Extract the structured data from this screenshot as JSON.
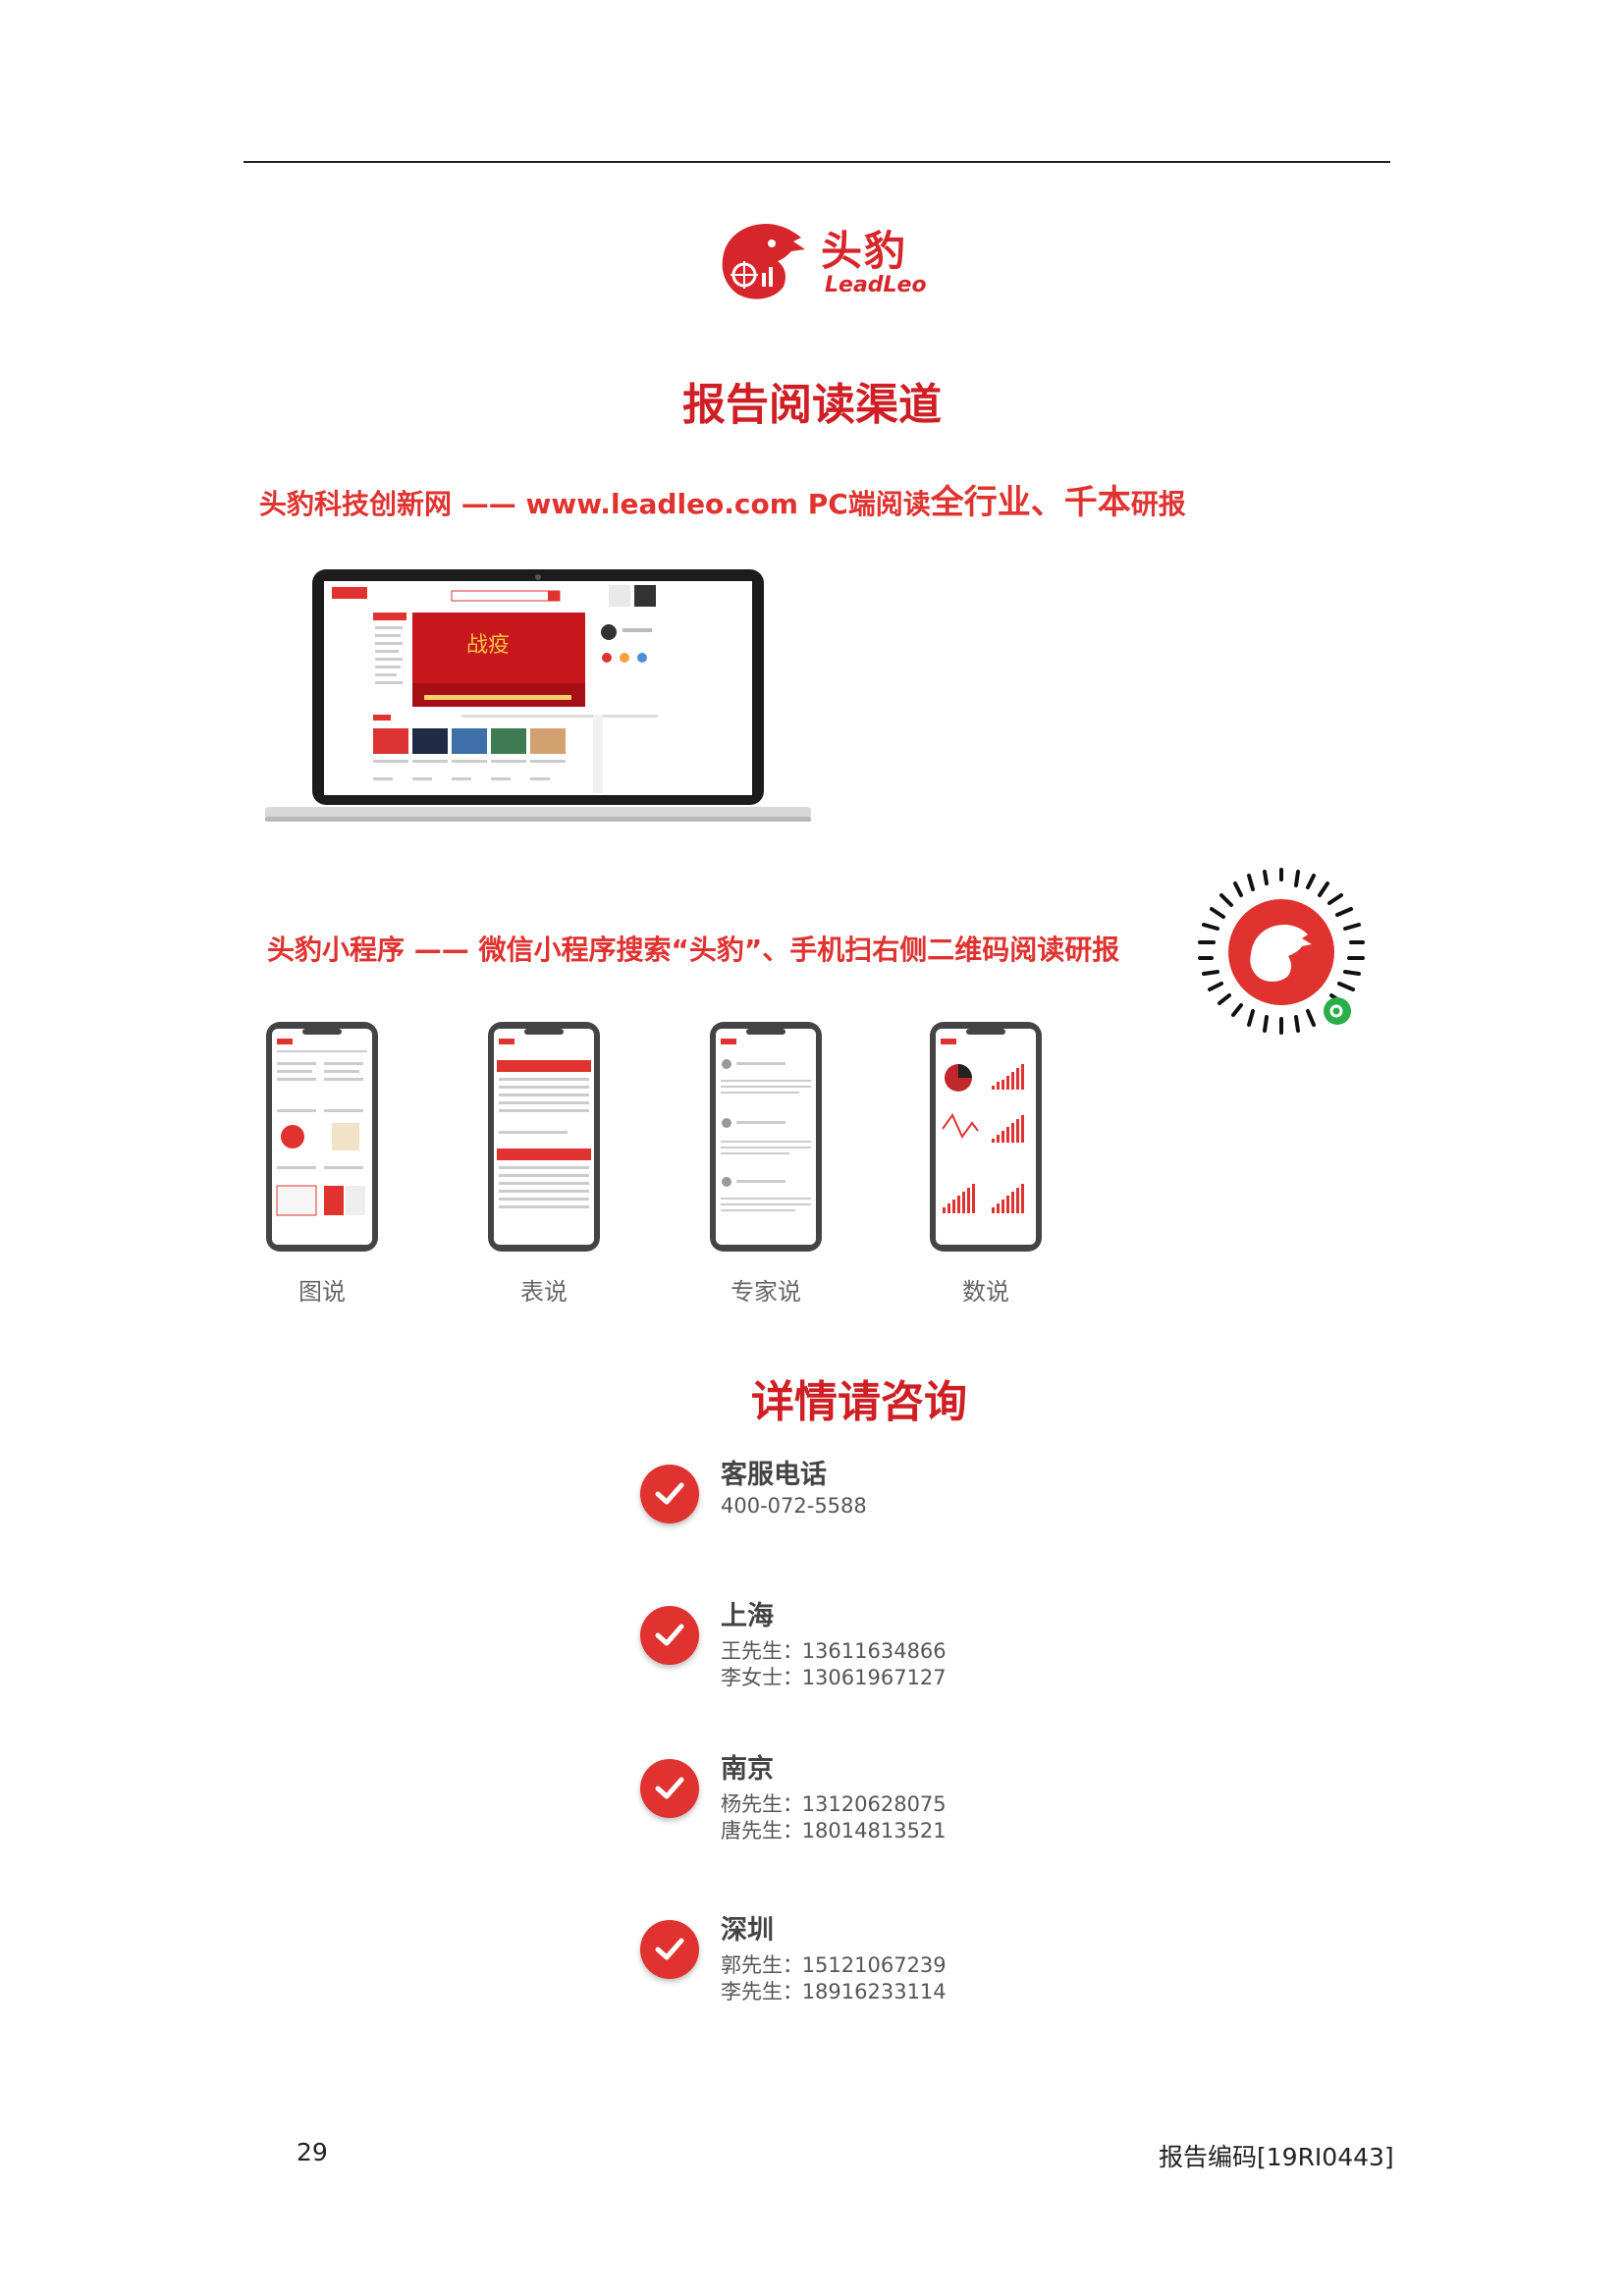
{
  "brand": {
    "name_cn": "头豹",
    "name_en": "LeadLeo"
  },
  "section_title": "报告阅读渠道",
  "pc_line": {
    "text": "头豹科技创新网 —— www.leadleo.com PC端阅读",
    "emph": "全行业、千本",
    "tail": "研报"
  },
  "mini_program_line": "头豹小程序 —— 微信小程序搜索“头豹”、手机扫右侧二维码阅读研报",
  "phones": [
    {
      "label": "图说"
    },
    {
      "label": "表说"
    },
    {
      "label": "专家说"
    },
    {
      "label": "数说"
    }
  ],
  "contact_title": "详情请咨询",
  "contacts": [
    {
      "title": "客服电话",
      "lines": [
        {
          "name": "",
          "value": "400-072-5588"
        }
      ]
    },
    {
      "title": "上海",
      "lines": [
        {
          "name": "王先生：",
          "value": "13611634866"
        },
        {
          "name": "李女士：",
          "value": "13061967127"
        }
      ]
    },
    {
      "title": "南京",
      "lines": [
        {
          "name": "杨先生：",
          "value": "13120628075"
        },
        {
          "name": "唐先生：",
          "value": "18014813521"
        }
      ]
    },
    {
      "title": "深圳",
      "lines": [
        {
          "name": "郭先生：",
          "value": "15121067239"
        },
        {
          "name": "李先生：",
          "value": "18916233114"
        }
      ]
    }
  ],
  "footer": {
    "page_number": "29",
    "report_code": "报告编码[19RI0443]"
  },
  "colors": {
    "brand_red": "#d7262b",
    "title_red": "#cf1f24",
    "text_gray": "#555555"
  }
}
